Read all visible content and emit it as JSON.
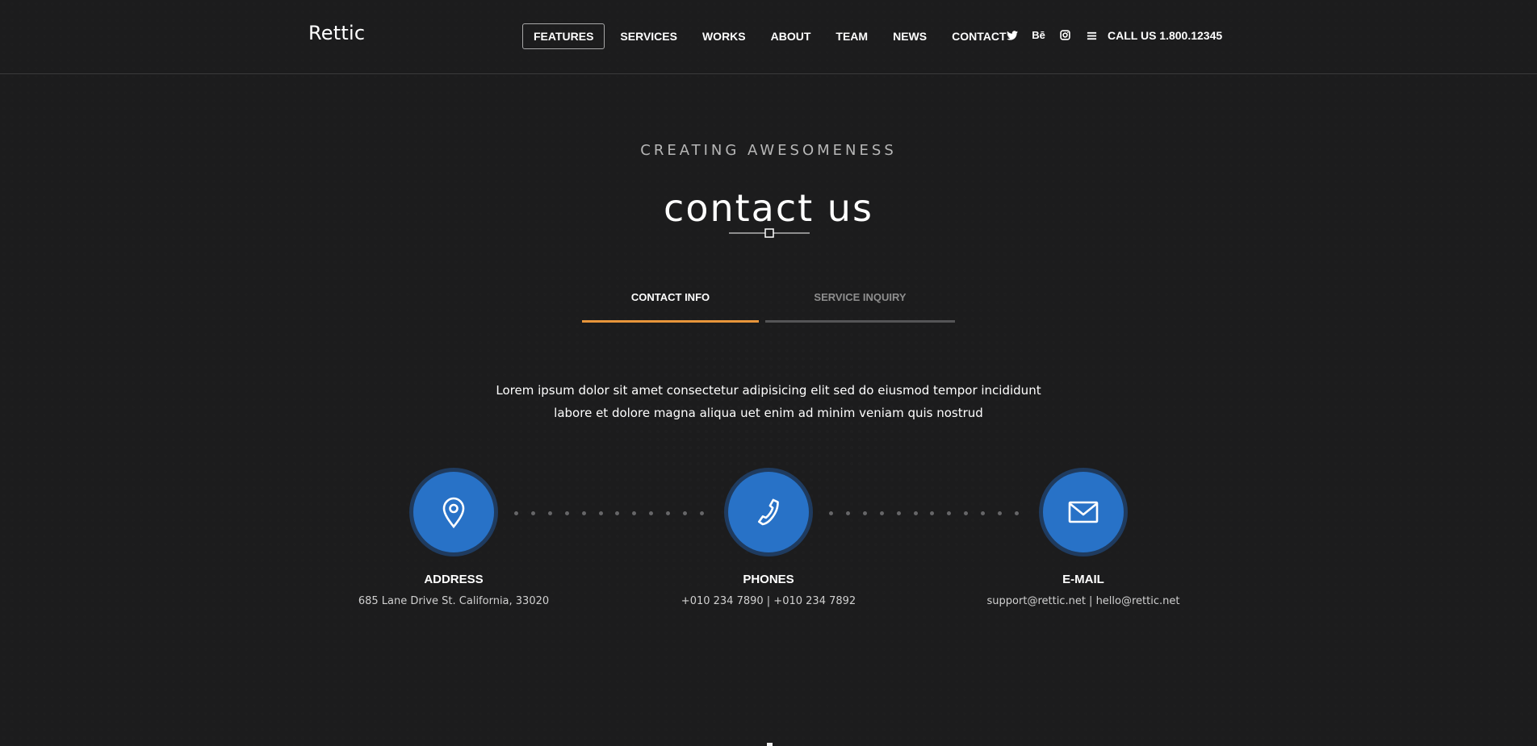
{
  "brand": {
    "name": "Rettic"
  },
  "nav": {
    "items": [
      {
        "label": "FEATURES",
        "active": true
      },
      {
        "label": "SERVICES",
        "active": false
      },
      {
        "label": "WORKS",
        "active": false
      },
      {
        "label": "ABOUT",
        "active": false
      },
      {
        "label": "TEAM",
        "active": false
      },
      {
        "label": "NEWS",
        "active": false
      },
      {
        "label": "CONTACT",
        "active": false
      }
    ],
    "social_icons": [
      {
        "name": "twitter-icon",
        "glyph": "t"
      },
      {
        "name": "behance-icon",
        "glyph": "Bē"
      },
      {
        "name": "instagram-icon",
        "glyph": "◎"
      }
    ],
    "call_label": "CALL US 1.800.12345"
  },
  "hero": {
    "eyebrow": "CREATING AWESOMENESS",
    "title": "contact us"
  },
  "tabs": {
    "items": [
      {
        "label": "CONTACT INFO",
        "active": true
      },
      {
        "label": "SERVICE INQUIRY",
        "active": false
      }
    ]
  },
  "intro": {
    "line1": "Lorem ipsum dolor sit amet consectetur adipisicing elit sed do eiusmod tempor incididunt",
    "line2": "labore et dolore magna aliqua uet enim ad minim veniam quis nostrud"
  },
  "contact": {
    "cards": [
      {
        "label": "ADDRESS",
        "value": "685 Lane Drive St. California, 33020",
        "icon": "location-pin-icon"
      },
      {
        "label": "PHONES",
        "value": "+010 234 7890 | +010 234 7892",
        "icon": "phone-icon"
      },
      {
        "label": "E-MAIL",
        "value": "support@rettic.net | hello@rettic.net",
        "icon": "mail-icon"
      }
    ]
  },
  "colors": {
    "background": "#1c1c1d",
    "accent": "#e7953b",
    "circle_blue": "#2872c7",
    "circle_ring": "#1f3b5f",
    "muted_text": "#b7b7b7"
  }
}
